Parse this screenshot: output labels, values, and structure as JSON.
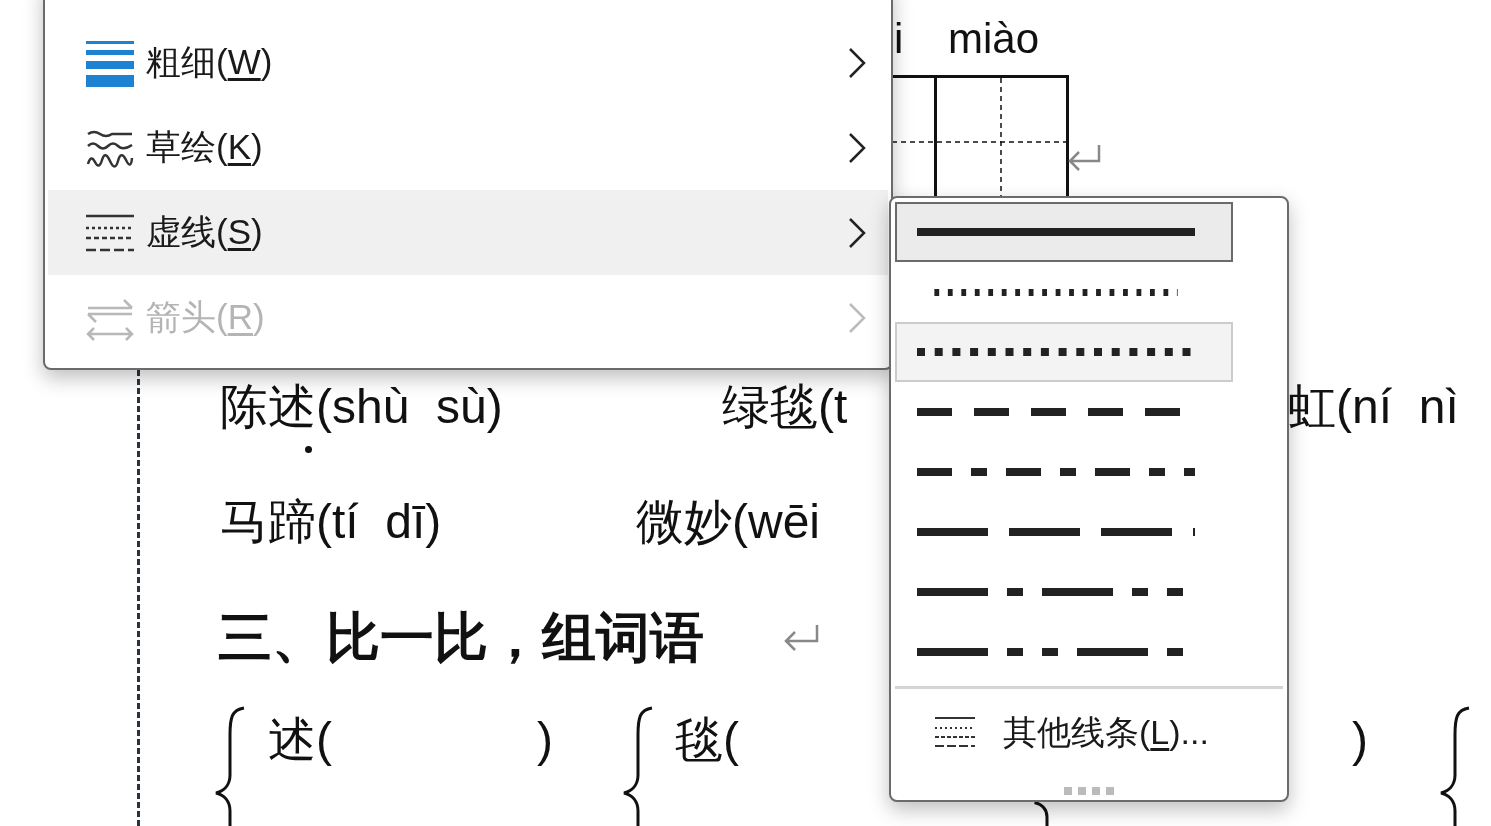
{
  "document": {
    "texts": [
      {
        "kind": "pinyin",
        "text": "i"
      },
      {
        "kind": "pinyin",
        "text": "miào"
      },
      {
        "kind": "word",
        "text": "陈述(shù  sù)"
      },
      {
        "kind": "word",
        "text": "绿毯(t"
      },
      {
        "kind": "word",
        "text": "虹(ní  nì"
      },
      {
        "kind": "word",
        "text": "马蹄(tí  dī)"
      },
      {
        "kind": "word",
        "text": "微妙(wēi"
      },
      {
        "kind": "heading",
        "text": "三、比一比，组词语"
      },
      {
        "kind": "word",
        "text": "述("
      },
      {
        "kind": "word",
        "text": ")"
      },
      {
        "kind": "word",
        "text": "毯("
      },
      {
        "kind": "word",
        "text": ")"
      }
    ]
  },
  "menu": {
    "items": [
      {
        "prefix": "粗细(",
        "key": "W",
        "suffix": ")",
        "selected": false,
        "disabled": false
      },
      {
        "prefix": "草绘(",
        "key": "K",
        "suffix": ")",
        "selected": false,
        "disabled": false
      },
      {
        "prefix": "虚线(",
        "key": "S",
        "suffix": ")",
        "selected": true,
        "disabled": false
      },
      {
        "prefix": "箭头(",
        "key": "R",
        "suffix": ")",
        "selected": false,
        "disabled": true
      }
    ]
  },
  "submenu": {
    "styles": [
      {
        "selected": true,
        "hovered": false
      },
      {
        "selected": false,
        "hovered": false
      },
      {
        "selected": false,
        "hovered": true
      },
      {
        "selected": false,
        "hovered": false
      },
      {
        "selected": false,
        "hovered": false
      },
      {
        "selected": false,
        "hovered": false
      },
      {
        "selected": false,
        "hovered": false
      },
      {
        "selected": false,
        "hovered": false
      }
    ],
    "more": {
      "prefix": "其他线条(",
      "key": "L",
      "suffix": ")..."
    }
  }
}
